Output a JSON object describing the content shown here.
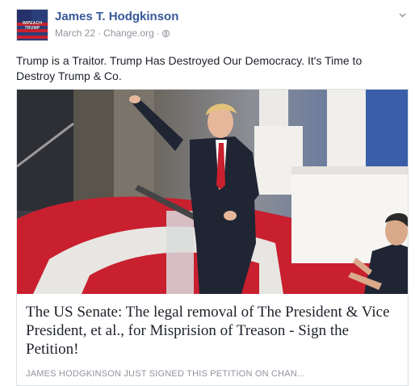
{
  "post": {
    "author_name": "James T. Hodgkinson",
    "date": "March 22",
    "separator": "·",
    "source": "Change.org",
    "separator2": "·",
    "privacy_icon": "globe-icon",
    "menu_icon": "chevron-down-icon",
    "avatar_text": "IMPEACH TRUMP",
    "text": "Trump is a Traitor. Trump Has Destroyed Our Democracy. It's Time to Destroy Trump & Co."
  },
  "link_card": {
    "title": "The US Senate: The legal removal of The President & Vice President, et al., for Misprision of Treason - Sign the Petition!",
    "caption": "JAMES HODGKINSON JUST SIGNED THIS PETITION ON CHAN..."
  },
  "colors": {
    "author_link": "#365899",
    "meta_gray": "#90949c",
    "text": "#1d2129",
    "border": "#dddfe2"
  }
}
